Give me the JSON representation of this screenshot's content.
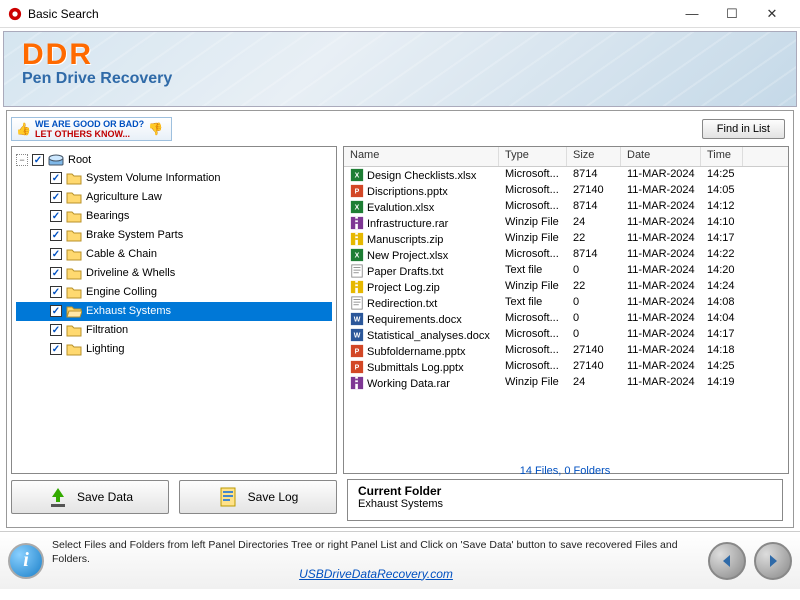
{
  "window": {
    "title": "Basic Search"
  },
  "banner": {
    "brand": "DDR",
    "subtitle": "Pen Drive Recovery"
  },
  "badge": {
    "line1": "WE ARE GOOD OR BAD?",
    "line2": "LET OTHERS KNOW..."
  },
  "buttons": {
    "find": "Find in List",
    "save_data": "Save Data",
    "save_log": "Save Log"
  },
  "tree": {
    "root": "Root",
    "items": [
      "System Volume Information",
      "Agriculture Law",
      "Bearings",
      "Brake System Parts",
      "Cable & Chain",
      "Driveline & Whells",
      "Engine Colling",
      "Exhaust Systems",
      "Filtration",
      "Lighting"
    ],
    "selected_index": 7
  },
  "columns": {
    "name": "Name",
    "type": "Type",
    "size": "Size",
    "date": "Date",
    "time": "Time"
  },
  "files": [
    {
      "icon": "xlsx",
      "name": "Design Checklists.xlsx",
      "type": "Microsoft...",
      "size": "8714",
      "date": "11-MAR-2024",
      "time": "14:25"
    },
    {
      "icon": "pptx",
      "name": "Discriptions.pptx",
      "type": "Microsoft...",
      "size": "27140",
      "date": "11-MAR-2024",
      "time": "14:05"
    },
    {
      "icon": "xlsx",
      "name": "Evalution.xlsx",
      "type": "Microsoft...",
      "size": "8714",
      "date": "11-MAR-2024",
      "time": "14:12"
    },
    {
      "icon": "rar",
      "name": "Infrastructure.rar",
      "type": "Winzip File",
      "size": "24",
      "date": "11-MAR-2024",
      "time": "14:10"
    },
    {
      "icon": "zip",
      "name": "Manuscripts.zip",
      "type": "Winzip File",
      "size": "22",
      "date": "11-MAR-2024",
      "time": "14:17"
    },
    {
      "icon": "xlsx",
      "name": "New Project.xlsx",
      "type": "Microsoft...",
      "size": "8714",
      "date": "11-MAR-2024",
      "time": "14:22"
    },
    {
      "icon": "txt",
      "name": "Paper Drafts.txt",
      "type": "Text file",
      "size": "0",
      "date": "11-MAR-2024",
      "time": "14:20"
    },
    {
      "icon": "zip",
      "name": "Project Log.zip",
      "type": "Winzip File",
      "size": "22",
      "date": "11-MAR-2024",
      "time": "14:24"
    },
    {
      "icon": "txt",
      "name": "Redirection.txt",
      "type": "Text file",
      "size": "0",
      "date": "11-MAR-2024",
      "time": "14:08"
    },
    {
      "icon": "docx",
      "name": "Requirements.docx",
      "type": "Microsoft...",
      "size": "0",
      "date": "11-MAR-2024",
      "time": "14:04"
    },
    {
      "icon": "docx",
      "name": "Statistical_analyses.docx",
      "type": "Microsoft...",
      "size": "0",
      "date": "11-MAR-2024",
      "time": "14:17"
    },
    {
      "icon": "pptx",
      "name": "Subfoldername.pptx",
      "type": "Microsoft...",
      "size": "27140",
      "date": "11-MAR-2024",
      "time": "14:18"
    },
    {
      "icon": "pptx",
      "name": "Submittals Log.pptx",
      "type": "Microsoft...",
      "size": "27140",
      "date": "11-MAR-2024",
      "time": "14:25"
    },
    {
      "icon": "rar",
      "name": "Working Data.rar",
      "type": "Winzip File",
      "size": "24",
      "date": "11-MAR-2024",
      "time": "14:19"
    }
  ],
  "status": {
    "count": "14 Files, 0 Folders",
    "current_label": "Current Folder",
    "current_value": "Exhaust Systems"
  },
  "hint": "Select Files and Folders from left Panel Directories Tree or right Panel List and Click on 'Save Data' button to save recovered Files and Folders.",
  "website": "USBDriveDataRecovery.com"
}
